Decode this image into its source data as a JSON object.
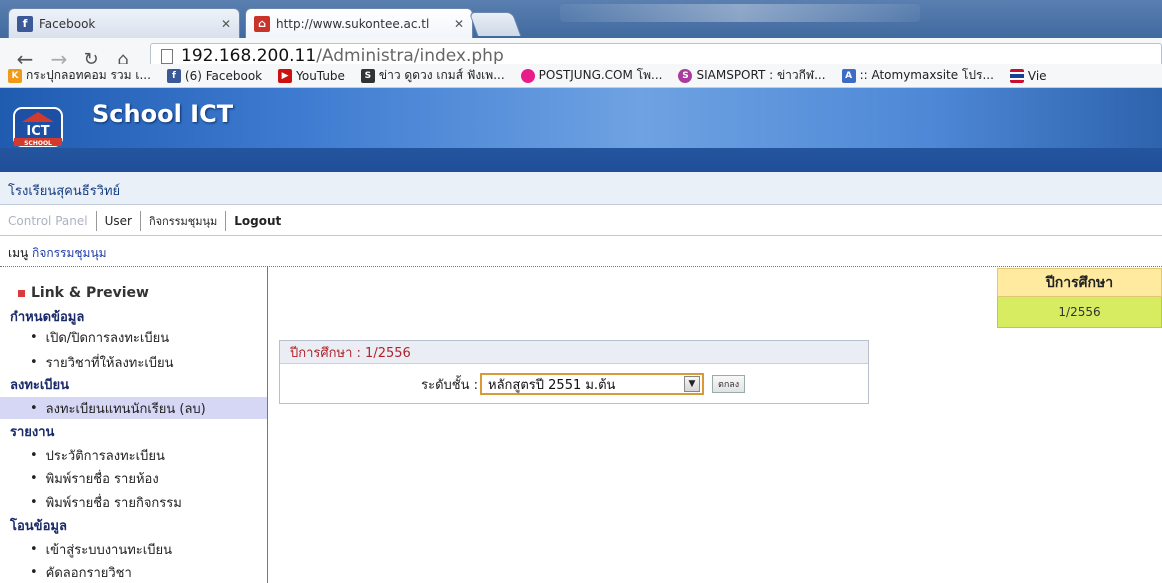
{
  "browser": {
    "tabs": [
      {
        "label": "Facebook",
        "favicon": "facebook-icon"
      },
      {
        "label": "http://www.sukontee.ac.tl",
        "favicon": "school-icon"
      }
    ],
    "address": {
      "host": "192.168.200.11",
      "path": "/Administra/index.php"
    },
    "bookmarks": [
      {
        "label": "กระปุกลอทคอม รวม เ...",
        "icon": "kapook-icon",
        "color": "#f09a1a"
      },
      {
        "label": "(6) Facebook",
        "icon": "facebook-icon",
        "color": "#3b5998"
      },
      {
        "label": "YouTube",
        "icon": "youtube-icon",
        "color": "#cc1111"
      },
      {
        "label": "ข่าว ดูดวง เกมส์ ฟังเพ...",
        "icon": "sanook-icon",
        "color": "#333333"
      },
      {
        "label": "POSTJUNG.COM โพ...",
        "icon": "postjung-icon",
        "color": "#e81c8a"
      },
      {
        "label": "SIAMSPORT : ข่าวกีฬ...",
        "icon": "siamsport-icon",
        "color": "#a93c9c"
      },
      {
        "label": ":: Atomymaxsite โปร...",
        "icon": "atomy-icon",
        "color": "#3d6cc6"
      },
      {
        "label": "Vie",
        "icon": "thai-flag-icon",
        "color": "#1c3f94"
      }
    ]
  },
  "site": {
    "name": "School ICT",
    "logo_text": "SCHOOL",
    "school": "โรงเรียนสุคนธีรวิทย์"
  },
  "menu": {
    "items": [
      "Control Panel",
      "User",
      "กิจกรรมชุมนุม",
      "Logout"
    ]
  },
  "breadcrumb": {
    "prefix": "เมนู",
    "link": "กิจกรรมชุมนุม"
  },
  "sidebar": {
    "preview": "Link & Preview",
    "sections": [
      {
        "title": "กำหนดข้อมูล",
        "items": [
          "เปิด/ปิดการลงทะเบียน",
          "รายวิชาที่ให้ลงทะเบียน"
        ]
      },
      {
        "title": "ลงทะเบียน",
        "items": [
          "ลงทะเบียนแทนนักเรียน (ลบ)"
        ]
      },
      {
        "title": "รายงาน",
        "items": [
          "ประวัติการลงทะเบียน",
          "พิมพ์รายชื่อ รายห้อง",
          "พิมพ์รายชื่อ รายกิจกรรม"
        ]
      },
      {
        "title": "โอนข้อมูล",
        "items": [
          "เข้าสู่ระบบงานทะเบียน",
          "คัดลอกรายวิชา"
        ]
      }
    ]
  },
  "panel": {
    "title": "ปีการศึกษา : 1/2556",
    "level_label": "ระดับชั้น :",
    "level_value": "หลักสูตรปี 2551 ม.ต้น",
    "submit": "ตกลง"
  },
  "yearbox": {
    "header": "ปีการศึกษา",
    "value": "1/2556"
  }
}
